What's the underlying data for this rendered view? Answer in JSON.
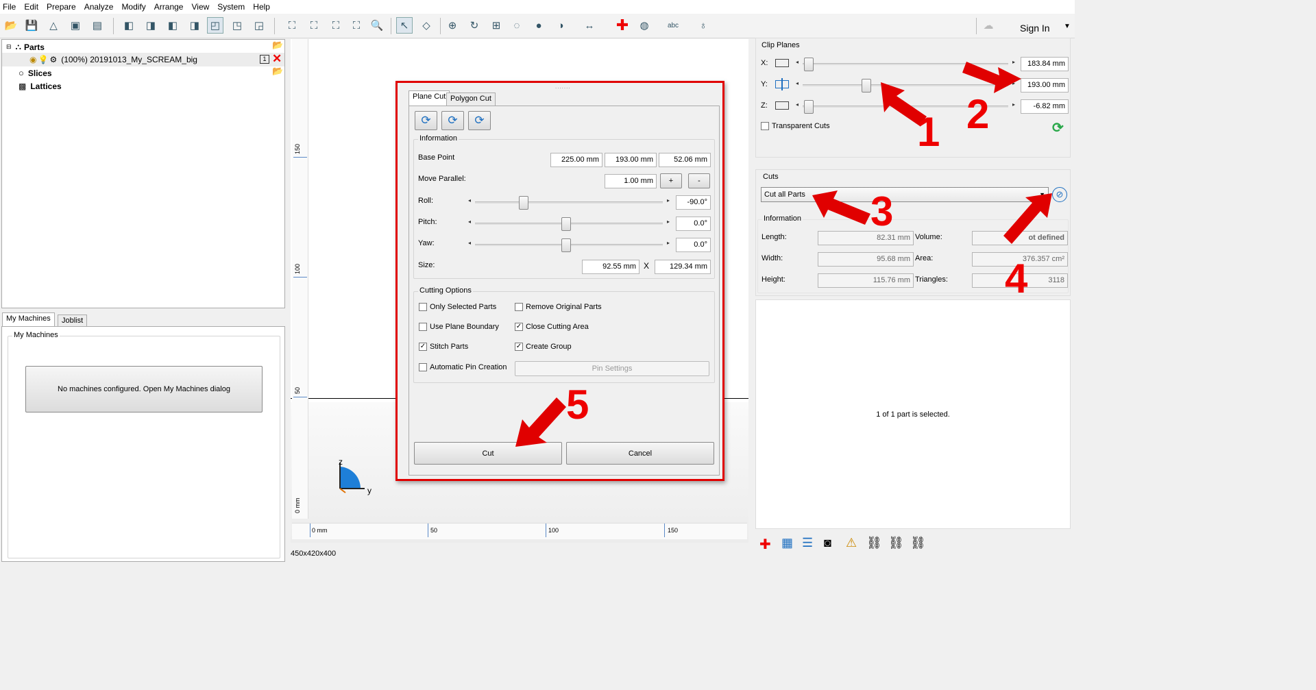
{
  "menu": [
    "File",
    "Edit",
    "Prepare",
    "Analyze",
    "Modify",
    "Arrange",
    "View",
    "System",
    "Help"
  ],
  "header": {
    "signin": "Sign In"
  },
  "tree": {
    "parts": "Parts",
    "part_item": "(100%) 20191013_My_SCREAM_big",
    "part_badge": "1",
    "slices": "Slices",
    "lattices": "Lattices"
  },
  "left_tabs": [
    "My Machines",
    "Joblist"
  ],
  "machines": {
    "group_title": "My Machines",
    "button": "No machines configured. Open My Machines dialog"
  },
  "viewport": {
    "ruler_left": [
      "150",
      "100",
      "50",
      "0 mm"
    ],
    "ruler_bottom": [
      "0 mm",
      "50",
      "100",
      "150"
    ],
    "axis_z": "z",
    "axis_y": "y",
    "status": "450x420x400"
  },
  "dialog": {
    "tabs": [
      "Plane Cut",
      "Polygon Cut"
    ],
    "info_title": "Information",
    "base_point_label": "Base Point",
    "base_point": [
      "225.00 mm",
      "193.00 mm",
      "52.06 mm"
    ],
    "move_parallel_label": "Move Parallel:",
    "move_parallel": "1.00 mm",
    "plus": "+",
    "minus": "-",
    "roll_label": "Roll:",
    "roll": "-90.0°",
    "pitch_label": "Pitch:",
    "pitch": "0.0°",
    "yaw_label": "Yaw:",
    "yaw": "0.0°",
    "size_label": "Size:",
    "size_w": "92.55 mm",
    "size_x": "X",
    "size_h": "129.34 mm",
    "cutting_title": "Cutting Options",
    "opt_only_selected": "Only Selected Parts",
    "opt_remove_original": "Remove Original Parts",
    "opt_plane_boundary": "Use Plane Boundary",
    "opt_close_area": "Close Cutting Area",
    "opt_stitch": "Stitch Parts",
    "opt_create_group": "Create Group",
    "opt_auto_pin": "Automatic Pin Creation",
    "pin_settings": "Pin Settings",
    "cut": "Cut",
    "cancel": "Cancel",
    "checks": {
      "only_selected": false,
      "remove_original": false,
      "plane_boundary": false,
      "close_area": true,
      "stitch": true,
      "create_group": true,
      "auto_pin": false
    }
  },
  "clip": {
    "title": "Clip Planes",
    "x_label": "X:",
    "y_label": "Y:",
    "z_label": "Z:",
    "x": "183.84 mm",
    "y": "193.00 mm",
    "z": "-6.82 mm",
    "transparent": "Transparent Cuts"
  },
  "cuts": {
    "title": "Cuts",
    "select": "Cut all Parts",
    "info_title": "Information",
    "length_label": "Length:",
    "length": "82.31 mm",
    "width_label": "Width:",
    "width": "95.68 mm",
    "height_label": "Height:",
    "height": "115.76 mm",
    "volume_label": "Volume:",
    "volume": "ot defined",
    "area_label": "Area:",
    "area": "376.357 cm²",
    "triangles_label": "Triangles:",
    "triangles": "3118",
    "selected_msg": "1 of 1 part is selected."
  },
  "annotations": [
    "1",
    "2",
    "3",
    "4",
    "5"
  ],
  "colors": {
    "accent_red": "#e00000",
    "dialog_border": "#e00000"
  }
}
